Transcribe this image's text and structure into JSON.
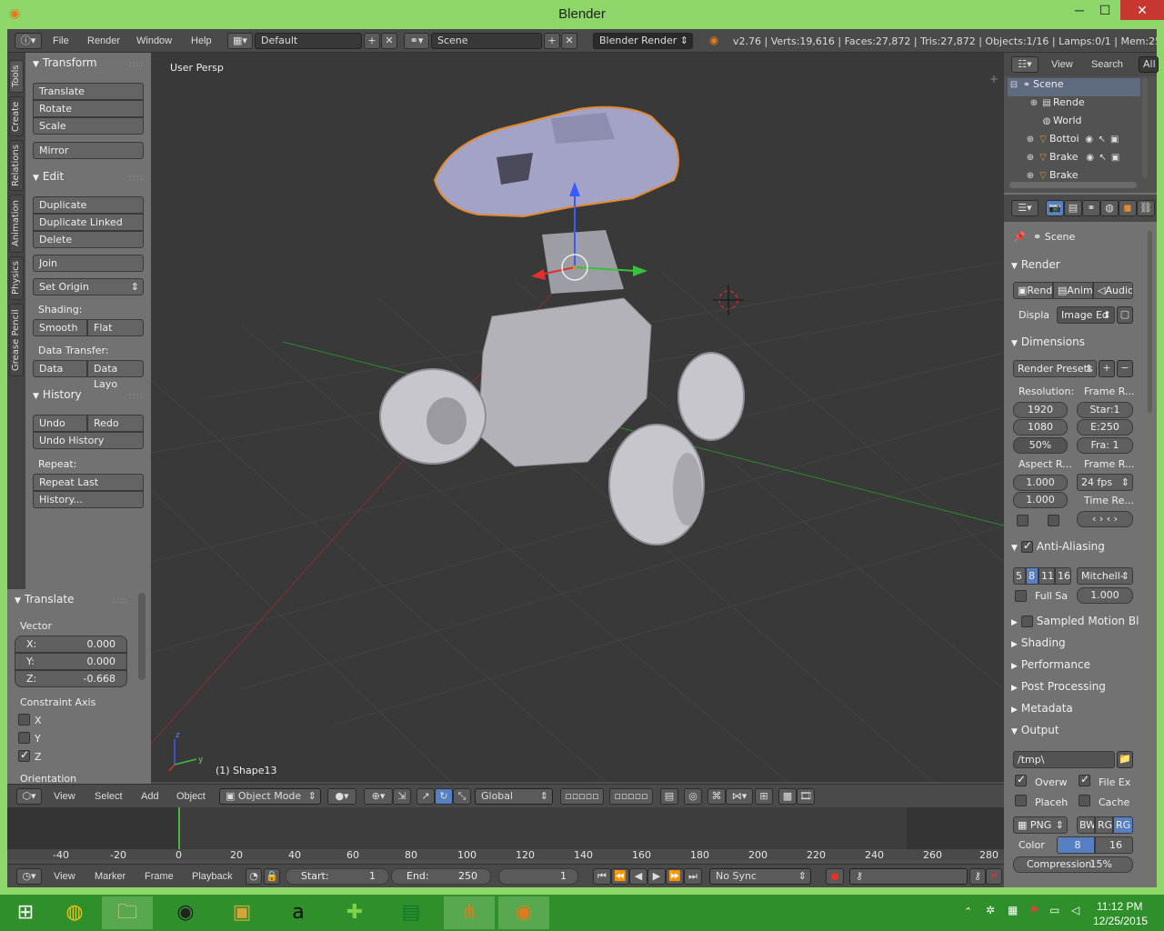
{
  "window": {
    "title": "Blender",
    "minimize": "─",
    "maximize": "☐",
    "close": "✕"
  },
  "info": {
    "menus": [
      "File",
      "Render",
      "Window",
      "Help"
    ],
    "layout": "Default",
    "scene": "Scene",
    "engine": "Blender Render",
    "stats": "v2.76 | Verts:19,616 | Faces:27,872 | Tris:27,872 | Objects:1/16 | Lamps:0/1 | Mem:25.28M"
  },
  "tabs": [
    "Tools",
    "Create",
    "Relations",
    "Animation",
    "Physics",
    "Grease Pencil"
  ],
  "tools": {
    "transform": {
      "title": "Transform",
      "translate": "Translate",
      "rotate": "Rotate",
      "scale": "Scale",
      "mirror": "Mirror"
    },
    "edit": {
      "title": "Edit",
      "duplicate": "Duplicate",
      "duplicate_linked": "Duplicate Linked",
      "delete": "Delete",
      "join": "Join",
      "set_origin": "Set Origin",
      "shading_label": "Shading:",
      "smooth": "Smooth",
      "flat": "Flat",
      "data_transfer_label": "Data Transfer:",
      "data": "Data",
      "data_layo": "Data Layo"
    },
    "history": {
      "title": "History",
      "undo": "Undo",
      "redo": "Redo",
      "undo_history": "Undo History",
      "repeat_label": "Repeat:",
      "repeat_last": "Repeat Last",
      "history": "History..."
    }
  },
  "operator": {
    "title": "Translate",
    "vector_label": "Vector",
    "x_label": "X:",
    "x": "0.000",
    "y_label": "Y:",
    "y": "0.000",
    "z_label": "Z:",
    "z": "-0.668",
    "constraint_label": "Constraint Axis",
    "cx": "X",
    "cy": "Y",
    "cz": "Z",
    "cz_checked": true,
    "orientation": "Orientation"
  },
  "viewport": {
    "label": "User Persp",
    "object": "(1) Shape13"
  },
  "view3d_header": {
    "view": "View",
    "select": "Select",
    "add": "Add",
    "object": "Object",
    "mode": "Object Mode",
    "orientation": "Global"
  },
  "timeline": {
    "ticks": [
      "-40",
      "-20",
      "0",
      "20",
      "40",
      "60",
      "80",
      "100",
      "120",
      "140",
      "160",
      "180",
      "200",
      "220",
      "240",
      "260",
      "280"
    ],
    "view": "View",
    "marker": "Marker",
    "frame": "Frame",
    "playback": "Playback",
    "start_label": "Start:",
    "start": "1",
    "end_label": "End:",
    "end": "250",
    "current": "1",
    "sync": "No Sync"
  },
  "outliner": {
    "view": "View",
    "search": "Search",
    "all": "All",
    "rows": [
      "Scene",
      "Rende",
      "World",
      "Bottoi",
      "Brake",
      "Brake"
    ]
  },
  "properties": {
    "scene": "Scene",
    "render": {
      "title": "Render",
      "btn_render": "Rend",
      "btn_anim": "Anim",
      "btn_audio": "Audio",
      "display_label": "Displa",
      "display": "Image Ed"
    },
    "dimensions": {
      "title": "Dimensions",
      "presets": "Render Presets",
      "resolution_label": "Resolution:",
      "frame_range_label": "Frame R...",
      "res_x": "1920",
      "res_y": "1080",
      "res_pct": "50%",
      "start": "Star:1",
      "end": "E:250",
      "frame": "Fra: 1",
      "aspect_label": "Aspect R...",
      "frame_rate_label": "Frame R...",
      "aspect_x": "1.000",
      "aspect_y": "1.000",
      "fps": "24 fps",
      "time_remap_label": "Time Re..."
    },
    "aa": {
      "title": "Anti-Aliasing",
      "samples": [
        "5",
        "8",
        "11",
        "16"
      ],
      "filter": "Mitchell-",
      "full_sample": "Full Sa",
      "size": "1.000"
    },
    "sections": [
      "Sampled Motion Bl",
      "Shading",
      "Performance",
      "Post Processing",
      "Metadata"
    ],
    "output": {
      "title": "Output",
      "path": "/tmp\\",
      "overwrite": "Overw",
      "file_ext": "File Ex",
      "placeholders": "Placeh",
      "cache": "Cache",
      "format": "PNG",
      "bw": "BW",
      "rgb": "RG",
      "rgba": "RG",
      "color_label": "Color",
      "depth8": "8",
      "depth16": "16",
      "compression": "Compression:",
      "compression_value": "15%"
    }
  },
  "taskbar": {
    "time": "11:12 PM",
    "date": "12/25/2015"
  },
  "colors": {
    "accent": "#5680c2",
    "selected": "#e38a2f",
    "frame": "#8cd66a"
  }
}
